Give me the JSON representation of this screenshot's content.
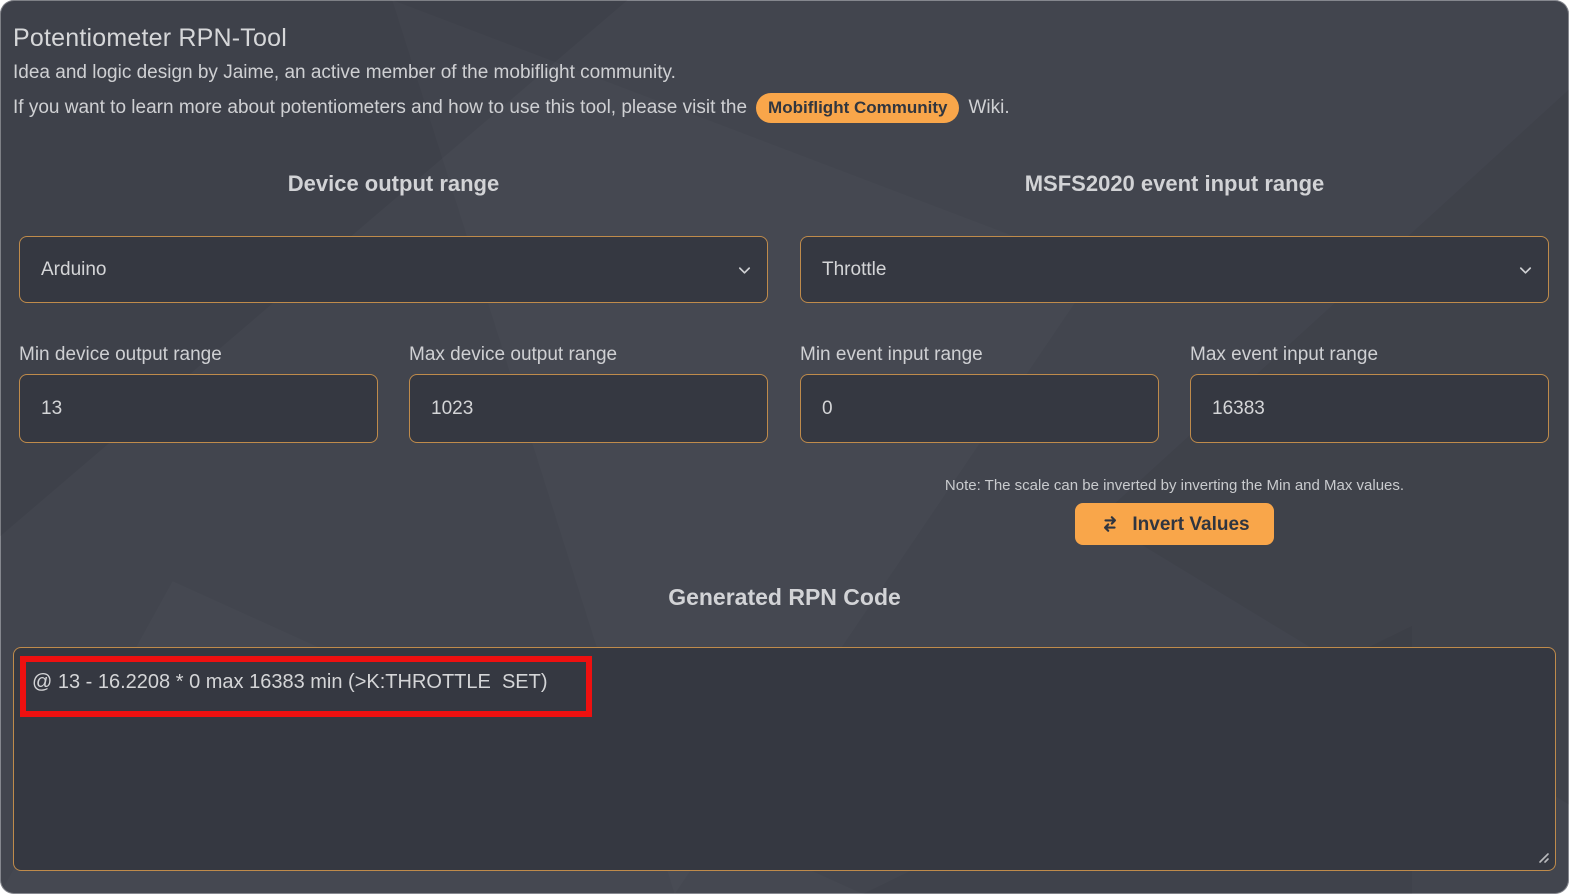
{
  "header": {
    "title": "Potentiometer RPN-Tool",
    "byline": "Idea and logic design by Jaime, an active member of the mobiflight community.",
    "learn_more_prefix": "If you want to learn more about potentiometers and how to use this tool, please visit the",
    "community_badge": "Mobiflight Community",
    "learn_more_suffix": "Wiki."
  },
  "device_output": {
    "heading": "Device output range",
    "device_select_value": "Arduino",
    "min_label": "Min device output range",
    "min_value": "13",
    "max_label": "Max device output range",
    "max_value": "1023"
  },
  "event_input": {
    "heading": "MSFS2020 event input range",
    "event_select_value": "Throttle",
    "min_label": "Min event input range",
    "min_value": "0",
    "max_label": "Max event input range",
    "max_value": "16383",
    "note": "Note: The scale can be inverted by inverting the Min and Max values.",
    "invert_button": "Invert Values"
  },
  "rpn": {
    "heading": "Generated RPN Code",
    "code": "@ 13 - 16.2208 * 0 max 16383 min (>K:THROTTLE  SET)"
  },
  "colors": {
    "accent_orange": "#f9a64a",
    "field_border": "#bf8b4b",
    "page_background": "#42454e",
    "field_background": "#353841",
    "annotation_red": "#ee1010"
  }
}
